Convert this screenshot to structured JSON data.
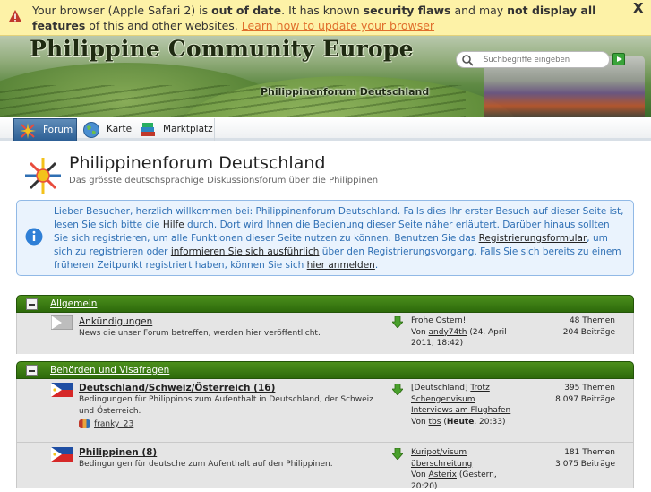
{
  "banner": {
    "part1": "Your browser (Apple Safari 2) is ",
    "bold1": "out of date",
    "part2": ". It has known ",
    "bold2": "security flaws",
    "part3": " and may ",
    "bold3": "not display all features",
    "part4": " of this and other websites. ",
    "link": "Learn how to update your browser",
    "close": "X"
  },
  "header": {
    "site_title": "Philippine Community Europe",
    "sub_title": "Philippinenforum Deutschland",
    "search_placeholder": "Suchbegriffe eingeben"
  },
  "nav": {
    "tabs": [
      {
        "label": "Forum",
        "active": true
      },
      {
        "label": "Karte",
        "active": false
      },
      {
        "label": "Marktplatz",
        "active": false
      }
    ]
  },
  "forum": {
    "title": "Philippinenforum Deutschland",
    "description": "Das grösste deutschsprachige Diskussionsforum über die Philippinen"
  },
  "info": {
    "t1": "Lieber Besucher, herzlich willkommen bei: Philippinenforum Deutschland. Falls dies Ihr erster Besuch auf dieser Seite ist, lesen Sie sich bitte die ",
    "l1": "Hilfe",
    "t2": " durch. Dort wird Ihnen die Bedienung dieser Seite näher erläutert. Darüber hinaus sollten Sie sich registrieren, um alle Funktionen dieser Seite nutzen zu können. Benutzen Sie das ",
    "l2": "Registrierungsformular",
    "t3": ", um sich zu registrieren oder ",
    "l3": "informieren Sie sich ausführlich",
    "t4": " über den Registrierungsvorgang. Falls Sie sich bereits zu einem früheren Zeitpunkt registriert haben, können Sie sich ",
    "l4": "hier anmelden",
    "t5": "."
  },
  "categories": [
    {
      "title": "Allgemein",
      "forums": [
        {
          "name": "Ankündigungen",
          "description": "News die unser Forum betreffen, werden hier veröffentlicht.",
          "last_title": "Frohe Ostern!",
          "last_by": "Von ",
          "last_user": "andy74th",
          "last_date": " (24. April 2011, 18:42)",
          "threads": "48 Themen",
          "posts": "204 Beiträge"
        }
      ]
    },
    {
      "title": "Behörden und Visafragen",
      "forums": [
        {
          "name": "Deutschland/Schweiz/Österreich (16)",
          "description": "Bedingungen für Philippinos zum Aufenthalt in Deutschland, der Schweiz und Österreich.",
          "moderator": "franky_23",
          "last_prefix": "[Deutschland] ",
          "last_title": "Trotz Schengenvisum Interviews am Flughafen",
          "last_by": "Von ",
          "last_user": "tbs",
          "last_date_open": " (",
          "last_date_bold": "Heute",
          "last_date_close": ", 20:33)",
          "threads": "395 Themen",
          "posts": "8 097 Beiträge"
        },
        {
          "name": "Philippinen (8)",
          "description": "Bedingungen für deutsche zum Aufenthalt auf den Philippinen.",
          "last_title": "Kuripot/visum überschreitung",
          "last_by": "Von ",
          "last_user": "Asterix",
          "last_date": " (Gestern, 20:20)",
          "threads": "181 Themen",
          "posts": "3 075 Beiträge"
        }
      ]
    }
  ],
  "colors": {
    "banner_bg": "#fdf2a7",
    "category_green": "#3c7d14",
    "info_text": "#2e6fb4",
    "tab_active": "#2d5f95"
  }
}
